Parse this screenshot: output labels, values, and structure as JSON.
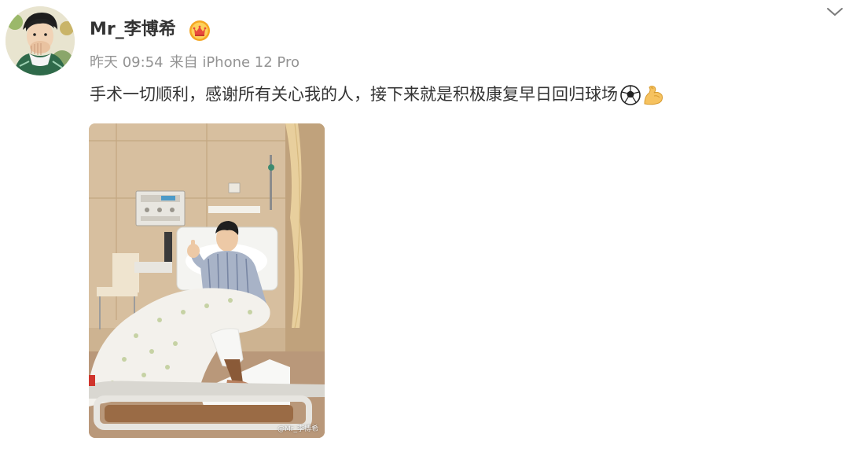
{
  "post": {
    "author": {
      "name": "Mr_李博希",
      "avatar_icon": "avatar-photo",
      "badge_icon": "crown-badge-icon"
    },
    "meta": {
      "time": "昨天 09:54",
      "source": "来自 iPhone 12 Pro"
    },
    "text": "手术一切顺利，感谢所有关心我的人，接下来就是积极康复早日回归球场",
    "emojis": [
      "soccer-ball-icon",
      "flexed-biceps-icon"
    ],
    "image": {
      "watermark": "@Mr_李博希"
    },
    "menu_icon": "chevron-down-icon"
  },
  "colors": {
    "text": "#333333",
    "meta": "#939393",
    "badge": "#f5a623"
  }
}
